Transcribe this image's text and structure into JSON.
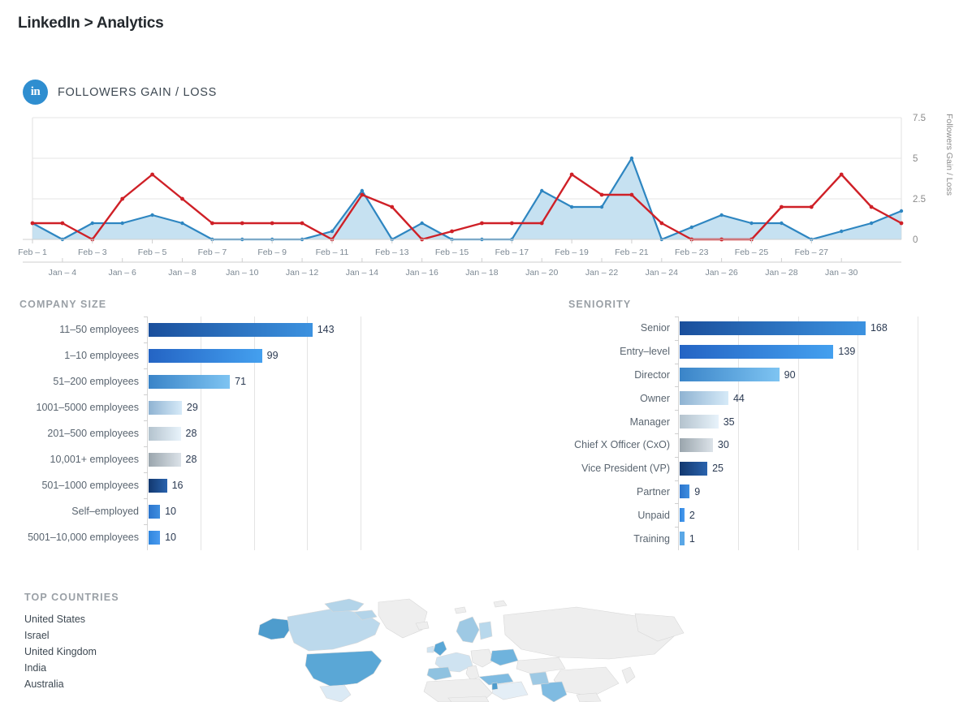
{
  "header": {
    "title": "LinkedIn > Analytics"
  },
  "followers_panel": {
    "icon": "linkedin-icon",
    "icon_glyph": "in",
    "title": "FOLLOWERS GAIN / LOSS",
    "accent_color": "#2f8ed0"
  },
  "sections": {
    "company_size_title": "COMPANY SIZE",
    "seniority_title": "SENIORITY",
    "top_countries_title": "TOP COUNTRIES"
  },
  "top_countries": [
    "United States",
    "Israel",
    "United Kingdom",
    "India",
    "Australia"
  ],
  "map": {
    "name": "world-choropleth-map",
    "highlight_colors": [
      "#4e9ccd",
      "#5aa7d6",
      "#a9cfe8",
      "#c9e1f2",
      "#e4eef6",
      "#eeeeee"
    ]
  },
  "chart_data": [
    {
      "type": "line",
      "title": "FOLLOWERS GAIN / LOSS",
      "ylabel": "Followers Gain / Loss",
      "xlabel": "",
      "ylim": [
        0,
        7.5
      ],
      "yticks": [
        0,
        2.5,
        5,
        7.5
      ],
      "ytick_labels": [
        "0",
        "2.5",
        "5",
        "7.5"
      ],
      "grid": true,
      "legend": "none",
      "x_axis_primary": [
        "Feb – 1",
        "Feb – 3",
        "Feb – 5",
        "Feb – 7",
        "Feb – 9",
        "Feb – 11",
        "Feb – 13",
        "Feb – 15",
        "Feb – 17",
        "Feb – 19",
        "Feb – 21",
        "Feb – 23",
        "Feb – 25",
        "Feb – 27"
      ],
      "x_axis_secondary": [
        "Jan – 4",
        "Jan – 6",
        "Jan – 8",
        "Jan – 10",
        "Jan – 12",
        "Jan – 14",
        "Jan – 16",
        "Jan – 18",
        "Jan – 20",
        "Jan – 22",
        "Jan – 24",
        "Jan – 26",
        "Jan – 28",
        "Jan – 30"
      ],
      "x": [
        1,
        2,
        3,
        4,
        5,
        6,
        7,
        8,
        9,
        10,
        11,
        12,
        13,
        14,
        15,
        16,
        17,
        18,
        19,
        20,
        21,
        22,
        23,
        24,
        25,
        26,
        27,
        28,
        29,
        30
      ],
      "series": [
        {
          "name": "Followers Gain",
          "color": "#2e86c1",
          "fill_color": "#bcdcef",
          "type": "area",
          "values": [
            1,
            0,
            1,
            1,
            1.5,
            1,
            0,
            0,
            0,
            0,
            0.5,
            3,
            0,
            1,
            0,
            0,
            0,
            3,
            2,
            2,
            5,
            0,
            0.75,
            1.5,
            1,
            1,
            0,
            0.5,
            1,
            1.75
          ]
        },
        {
          "name": "Followers Loss",
          "color": "#cf2027",
          "type": "line",
          "values": [
            1,
            1,
            0,
            2.5,
            4,
            2.5,
            1,
            1,
            1,
            1,
            0,
            2.75,
            2,
            0,
            0.5,
            1,
            1,
            1,
            4,
            2.75,
            2.75,
            1,
            0,
            0,
            0,
            2,
            2,
            4,
            2,
            1
          ]
        }
      ]
    },
    {
      "type": "bar",
      "orientation": "horizontal",
      "title": "COMPANY SIZE",
      "xlabel": "",
      "ylabel": "",
      "xlim": [
        0,
        185
      ],
      "grid": true,
      "categories": [
        "11–50 employees",
        "1–10 employees",
        "51–200 employees",
        "1001–5000 employees",
        "201–500 employees",
        "10,001+ employees",
        "501–1000 employees",
        "Self–employed",
        "5001–10,000 employees"
      ],
      "values": [
        143,
        99,
        71,
        29,
        28,
        28,
        16,
        10,
        10
      ],
      "bar_colors": [
        {
          "from": "#1a4f9c",
          "to": "#3c92e0"
        },
        {
          "from": "#2464c4",
          "to": "#44a0ef"
        },
        {
          "from": "#3a84c8",
          "to": "#7ec4f2"
        },
        {
          "from": "#8fb3d2",
          "to": "#d6eaf8"
        },
        {
          "from": "#b4c3ce",
          "to": "#e8f3fb"
        },
        {
          "from": "#9aa5ad",
          "to": "#dce3e9"
        },
        {
          "from": "#12386f",
          "to": "#2a63ad"
        },
        {
          "from": "#2b74cc",
          "to": "#3f8fe0"
        },
        {
          "from": "#2f85dd",
          "to": "#4a9bf0"
        }
      ]
    },
    {
      "type": "bar",
      "orientation": "horizontal",
      "title": "SENIORITY",
      "xlabel": "",
      "ylabel": "",
      "xlim": [
        0,
        215
      ],
      "grid": true,
      "categories": [
        "Senior",
        "Entry–level",
        "Director",
        "Owner",
        "Manager",
        "Chief X Officer (CxO)",
        "Vice President (VP)",
        "Partner",
        "Unpaid",
        "Training"
      ],
      "values": [
        168,
        139,
        90,
        44,
        35,
        30,
        25,
        9,
        2,
        1
      ],
      "bar_colors": [
        {
          "from": "#1a4f9c",
          "to": "#3c92e0"
        },
        {
          "from": "#2464c4",
          "to": "#44a0ef"
        },
        {
          "from": "#3a84c8",
          "to": "#7ec4f2"
        },
        {
          "from": "#8fb3d2",
          "to": "#d6eaf8"
        },
        {
          "from": "#b4c3ce",
          "to": "#e8f3fb"
        },
        {
          "from": "#9aa5ad",
          "to": "#dce3e9"
        },
        {
          "from": "#12386f",
          "to": "#2a63ad"
        },
        {
          "from": "#2b74cc",
          "to": "#3f8fe0"
        },
        {
          "from": "#2f85dd",
          "to": "#4a9bf0"
        },
        {
          "from": "#5aa7e6",
          "to": "#5aa7e6"
        }
      ]
    }
  ]
}
